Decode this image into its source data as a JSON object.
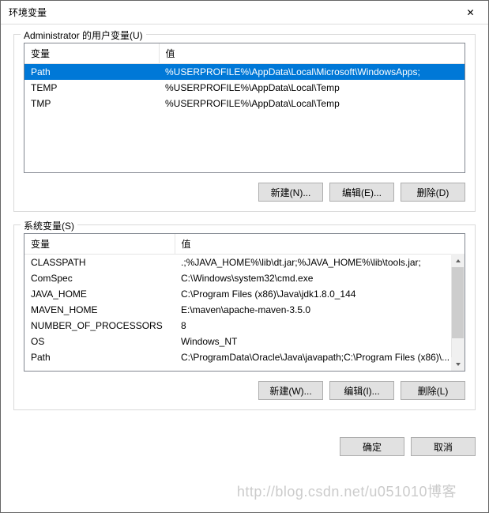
{
  "titlebar": {
    "title": "环境变量",
    "close_glyph": "✕"
  },
  "user_group": {
    "label": "Administrator 的用户变量(U)",
    "columns": {
      "name": "变量",
      "value": "值"
    },
    "rows": [
      {
        "name": "Path",
        "value": "%USERPROFILE%\\AppData\\Local\\Microsoft\\WindowsApps;",
        "selected": true
      },
      {
        "name": "TEMP",
        "value": "%USERPROFILE%\\AppData\\Local\\Temp",
        "selected": false
      },
      {
        "name": "TMP",
        "value": "%USERPROFILE%\\AppData\\Local\\Temp",
        "selected": false
      }
    ],
    "buttons": {
      "new": "新建(N)...",
      "edit": "编辑(E)...",
      "delete": "删除(D)"
    }
  },
  "sys_group": {
    "label": "系统变量(S)",
    "columns": {
      "name": "变量",
      "value": "值"
    },
    "rows": [
      {
        "name": "CLASSPATH",
        "value": ".;%JAVA_HOME%\\lib\\dt.jar;%JAVA_HOME%\\lib\\tools.jar;"
      },
      {
        "name": "ComSpec",
        "value": "C:\\Windows\\system32\\cmd.exe"
      },
      {
        "name": "JAVA_HOME",
        "value": "C:\\Program Files (x86)\\Java\\jdk1.8.0_144"
      },
      {
        "name": "MAVEN_HOME",
        "value": "E:\\maven\\apache-maven-3.5.0"
      },
      {
        "name": "NUMBER_OF_PROCESSORS",
        "value": "8"
      },
      {
        "name": "OS",
        "value": "Windows_NT"
      },
      {
        "name": "Path",
        "value": "C:\\ProgramData\\Oracle\\Java\\javapath;C:\\Program Files (x86)\\..."
      }
    ],
    "buttons": {
      "new": "新建(W)...",
      "edit": "编辑(I)...",
      "delete": "删除(L)"
    }
  },
  "dialog_buttons": {
    "ok": "确定",
    "cancel": "取消"
  },
  "watermark": "http://blog.csdn.net/u051010博客"
}
